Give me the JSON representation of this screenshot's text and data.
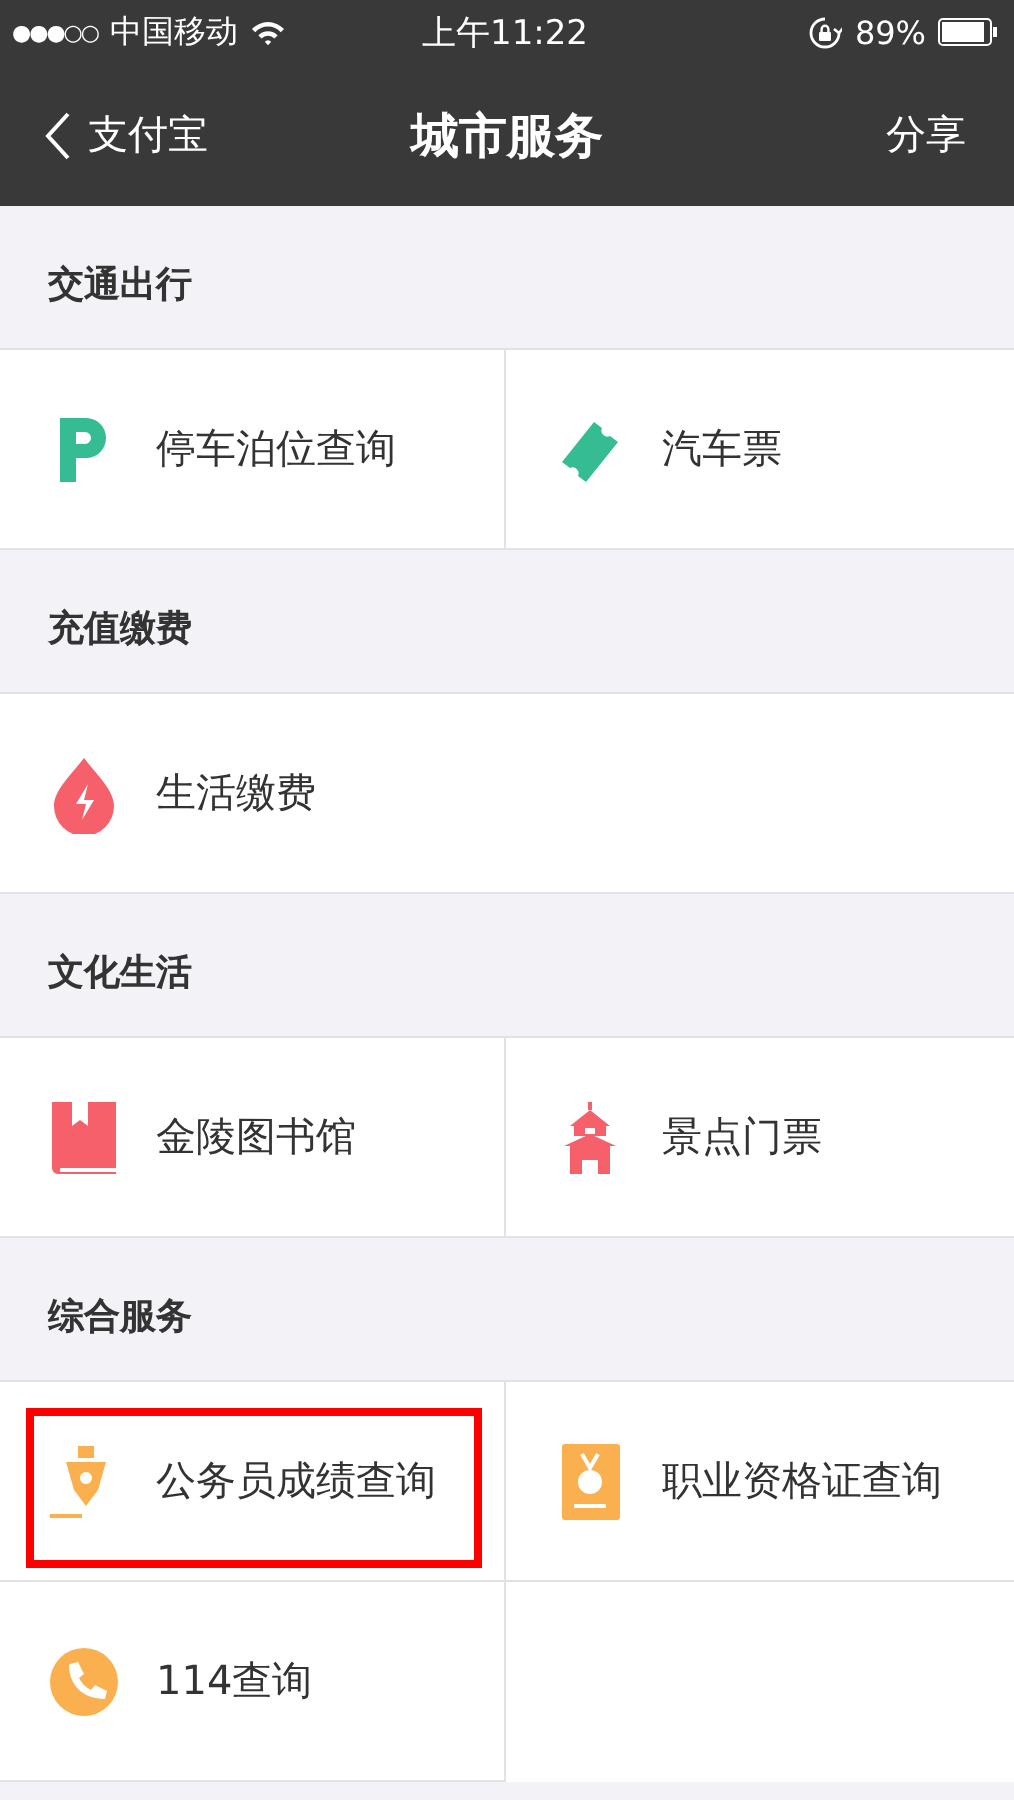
{
  "status_bar": {
    "signal": "●●●○○",
    "carrier": "中国移动",
    "time": "上午11:22",
    "battery": "89%"
  },
  "nav_bar": {
    "back_label": "支付宝",
    "title": "城市服务",
    "action": "分享"
  },
  "sections": [
    {
      "title": "交通出行",
      "items": [
        {
          "label": "停车泊位查询",
          "kind": "parking",
          "highlighted": false
        },
        {
          "label": "汽车票",
          "kind": "ticket",
          "highlighted": false
        }
      ]
    },
    {
      "title": "充值缴费",
      "items": [
        {
          "label": "生活缴费",
          "kind": "drop",
          "highlighted": false
        }
      ]
    },
    {
      "title": "文化生活",
      "items": [
        {
          "label": "金陵图书馆",
          "kind": "book",
          "highlighted": false
        },
        {
          "label": "景点门票",
          "kind": "temple",
          "highlighted": false
        }
      ]
    },
    {
      "title": "综合服务",
      "items": [
        {
          "label": "公务员成绩查询",
          "kind": "pen",
          "highlighted": true
        },
        {
          "label": "职业资格证查询",
          "kind": "certificate",
          "highlighted": false
        },
        {
          "label": "114查询",
          "kind": "phone",
          "highlighted": false
        }
      ]
    }
  ]
}
